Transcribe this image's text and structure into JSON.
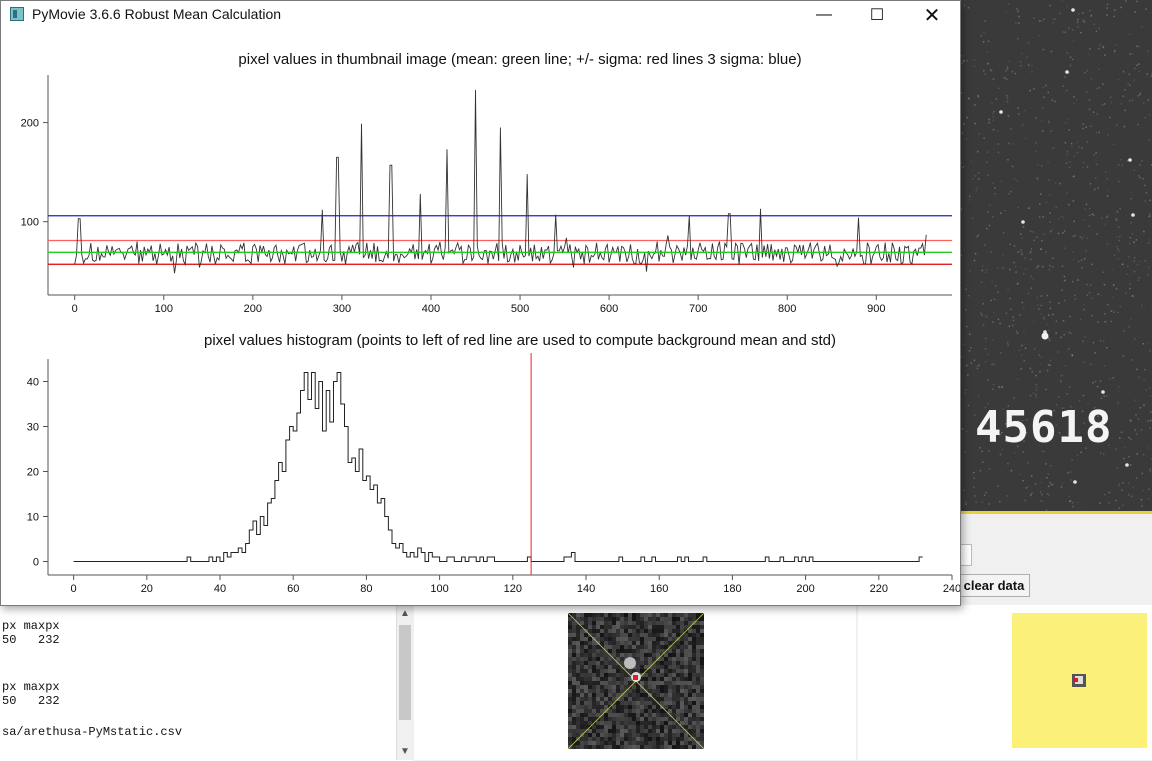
{
  "window": {
    "title": "PyMovie 3.6.6 Robust Mean Calculation",
    "minimize_glyph": "—",
    "maximize_glyph": "☐",
    "close_glyph": "✕"
  },
  "background": {
    "timestamp": "45618",
    "clear_data_label": "clear data",
    "log_lines": [
      "px maxpx",
      "50   232",
      "px maxpx",
      "50   232",
      "sa/arethusa-PyMstatic.csv"
    ],
    "colors": {
      "highlight_yellow": "#fbf07a",
      "video_border": "#e8d23a"
    }
  },
  "chart_data": [
    {
      "type": "line",
      "title": "pixel values in thumbnail image (mean: green line; +/- sigma: red lines 3 sigma: blue)",
      "xlim": [
        -30,
        985
      ],
      "ylim": [
        26,
        248
      ],
      "x_ticks": [
        0,
        100,
        200,
        300,
        400,
        500,
        600,
        700,
        800,
        900
      ],
      "y_ticks": [
        100,
        200
      ],
      "grid": false,
      "series": [
        {
          "color": "#333333",
          "x_start": 0,
          "x_end": 957,
          "base": 68,
          "noise": 11,
          "spikes": [
            [
              5,
              103
            ],
            [
              278,
              112
            ],
            [
              295,
              165
            ],
            [
              322,
              199
            ],
            [
              355,
              157
            ],
            [
              388,
              128
            ],
            [
              418,
              173
            ],
            [
              450,
              233
            ],
            [
              478,
              195
            ],
            [
              508,
              148
            ],
            [
              540,
              107
            ],
            [
              690,
              106
            ],
            [
              735,
              108
            ],
            [
              770,
              113
            ],
            [
              880,
              104
            ]
          ]
        }
      ],
      "hlines": [
        {
          "value": 106,
          "color": "#2020c8"
        },
        {
          "value": 81,
          "color": "#ff5f5f"
        },
        {
          "value": 69,
          "color": "#22cc22"
        },
        {
          "value": 57,
          "color": "#dd0000"
        }
      ]
    },
    {
      "type": "line",
      "step": true,
      "title": "pixel values histogram (points to left of red line are used to compute background mean and std)",
      "xlim": [
        -7,
        240
      ],
      "ylim": [
        -3,
        45
      ],
      "x_ticks": [
        0,
        20,
        40,
        60,
        80,
        100,
        120,
        140,
        160,
        180,
        200,
        220,
        240
      ],
      "y_ticks": [
        0,
        10,
        20,
        30,
        40
      ],
      "grid": false,
      "vline": {
        "value": 125,
        "color": "#ee2222"
      },
      "series": [
        {
          "color": "#222222",
          "x_start": 0,
          "x_end": 232,
          "points": [
            [
              0,
              0
            ],
            [
              30,
              0
            ],
            [
              31,
              1
            ],
            [
              32,
              0
            ],
            [
              36,
              0
            ],
            [
              37,
              1
            ],
            [
              38,
              0
            ],
            [
              39,
              1
            ],
            [
              40,
              0
            ],
            [
              41,
              2
            ],
            [
              42,
              1
            ],
            [
              43,
              2
            ],
            [
              44,
              2
            ],
            [
              45,
              3
            ],
            [
              46,
              2
            ],
            [
              47,
              4
            ],
            [
              48,
              7
            ],
            [
              49,
              9
            ],
            [
              50,
              6
            ],
            [
              51,
              10
            ],
            [
              52,
              8
            ],
            [
              53,
              13
            ],
            [
              54,
              14
            ],
            [
              55,
              18
            ],
            [
              56,
              22
            ],
            [
              57,
              20
            ],
            [
              58,
              27
            ],
            [
              59,
              30
            ],
            [
              60,
              29
            ],
            [
              61,
              33
            ],
            [
              62,
              38
            ],
            [
              63,
              42
            ],
            [
              64,
              36
            ],
            [
              65,
              42
            ],
            [
              66,
              34
            ],
            [
              67,
              40
            ],
            [
              68,
              29
            ],
            [
              69,
              38
            ],
            [
              70,
              31
            ],
            [
              71,
              40
            ],
            [
              72,
              42
            ],
            [
              73,
              35
            ],
            [
              74,
              30
            ],
            [
              75,
              22
            ],
            [
              76,
              23
            ],
            [
              77,
              20
            ],
            [
              78,
              25
            ],
            [
              79,
              18
            ],
            [
              80,
              19
            ],
            [
              81,
              16
            ],
            [
              82,
              17
            ],
            [
              83,
              13
            ],
            [
              84,
              14
            ],
            [
              85,
              10
            ],
            [
              86,
              7
            ],
            [
              87,
              4
            ],
            [
              88,
              3
            ],
            [
              89,
              4
            ],
            [
              90,
              2
            ],
            [
              91,
              1
            ],
            [
              92,
              2
            ],
            [
              93,
              1
            ],
            [
              94,
              3
            ],
            [
              95,
              2
            ],
            [
              96,
              0
            ],
            [
              97,
              2
            ],
            [
              98,
              1
            ],
            [
              100,
              0
            ],
            [
              102,
              1
            ],
            [
              104,
              0
            ],
            [
              106,
              1
            ],
            [
              107,
              0
            ],
            [
              108,
              1
            ],
            [
              110,
              0
            ],
            [
              111,
              1
            ],
            [
              112,
              0
            ],
            [
              113,
              1
            ],
            [
              115,
              0
            ],
            [
              124,
              1
            ],
            [
              125,
              0
            ],
            [
              134,
              1
            ],
            [
              136,
              2
            ],
            [
              137,
              0
            ],
            [
              149,
              1
            ],
            [
              150,
              0
            ],
            [
              155,
              1
            ],
            [
              156,
              0
            ],
            [
              158,
              1
            ],
            [
              159,
              0
            ],
            [
              165,
              1
            ],
            [
              166,
              0
            ],
            [
              167,
              1
            ],
            [
              168,
              0
            ],
            [
              172,
              1
            ],
            [
              173,
              0
            ],
            [
              189,
              1
            ],
            [
              190,
              0
            ],
            [
              193,
              1
            ],
            [
              194,
              0
            ],
            [
              197,
              1
            ],
            [
              198,
              0
            ],
            [
              199,
              1
            ],
            [
              200,
              0
            ],
            [
              201,
              1
            ],
            [
              202,
              0
            ],
            [
              231,
              1
            ],
            [
              232,
              1
            ]
          ]
        }
      ]
    }
  ]
}
